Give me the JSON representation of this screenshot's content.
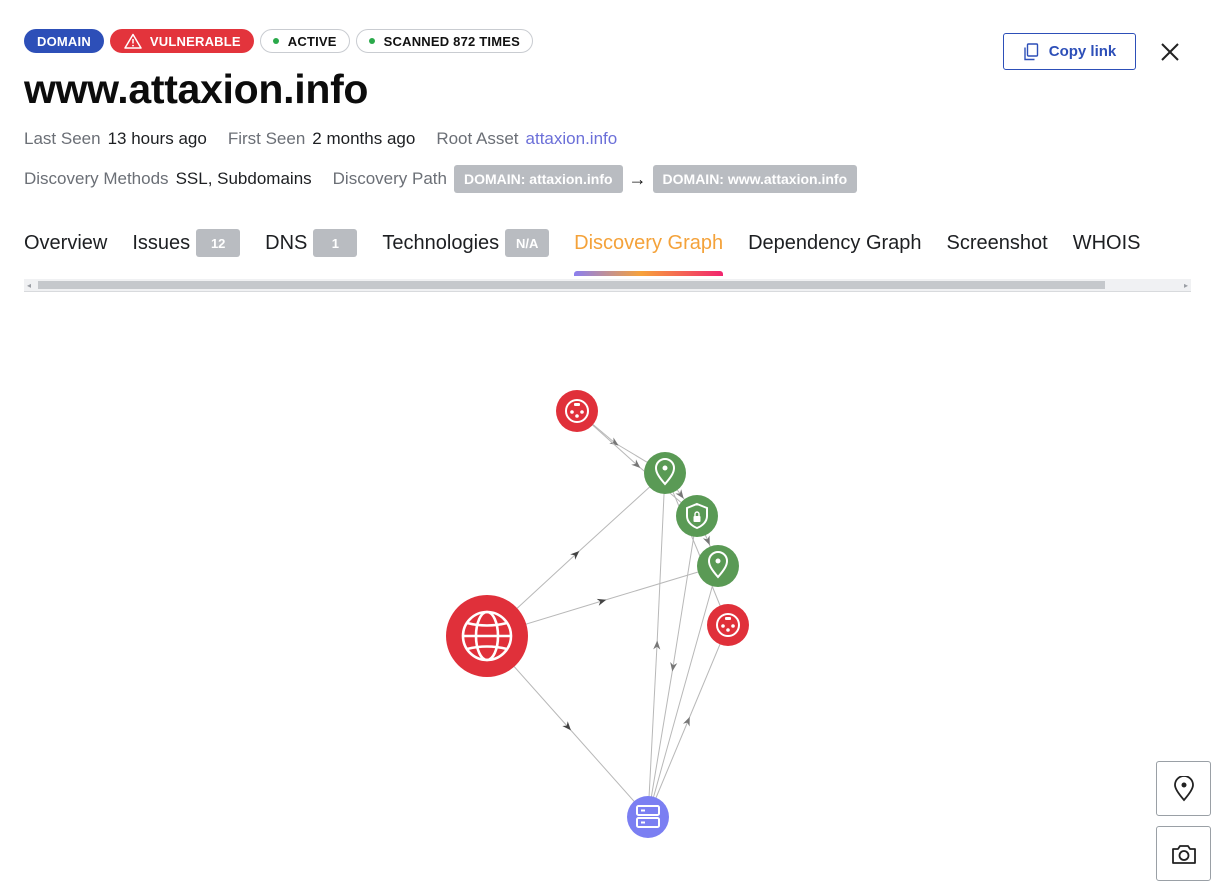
{
  "header": {
    "badges": {
      "type": "DOMAIN",
      "severity": "VULNERABLE",
      "status": "ACTIVE",
      "scans": "SCANNED 872 TIMES"
    },
    "copy_link_label": "Copy link",
    "title": "www.attaxion.info"
  },
  "meta": {
    "last_seen_key": "Last Seen",
    "last_seen_value": "13 hours ago",
    "first_seen_key": "First Seen",
    "first_seen_value": "2 months ago",
    "root_asset_key": "Root Asset",
    "root_asset_value": "attaxion.info",
    "discovery_methods_key": "Discovery Methods",
    "discovery_methods_value": "SSL, Subdomains",
    "discovery_path_key": "Discovery Path",
    "discovery_path_from": "DOMAIN: attaxion.info",
    "discovery_path_arrow": "→",
    "discovery_path_to": "DOMAIN: www.attaxion.info"
  },
  "tabs": [
    {
      "label": "Overview"
    },
    {
      "label": "Issues",
      "count": "12"
    },
    {
      "label": "DNS",
      "count": "1"
    },
    {
      "label": "Technologies",
      "count": "N/A"
    },
    {
      "label": "Discovery Graph",
      "active": true
    },
    {
      "label": "Dependency Graph"
    },
    {
      "label": "Screenshot"
    },
    {
      "label": "WHOIS"
    }
  ],
  "graph": {
    "nodes": [
      {
        "id": "target",
        "kind": "domain",
        "icon": "globe-icon",
        "color": "#e0303a"
      },
      {
        "id": "cert-top",
        "kind": "certificate",
        "icon": "certificate-icon",
        "color": "#e0303a"
      },
      {
        "id": "loc-1",
        "kind": "location",
        "icon": "map-pin-icon",
        "color": "#5a9a55"
      },
      {
        "id": "ssl",
        "kind": "ssl",
        "icon": "shield-lock-icon",
        "color": "#5a9a55"
      },
      {
        "id": "loc-2",
        "kind": "location",
        "icon": "map-pin-icon",
        "color": "#5a9a55"
      },
      {
        "id": "cert-right",
        "kind": "certificate",
        "icon": "certificate-icon",
        "color": "#e0303a"
      },
      {
        "id": "server",
        "kind": "server",
        "icon": "server-icon",
        "color": "#7b7ff2"
      }
    ]
  },
  "side_controls": {
    "locate_icon": "map-pin-icon",
    "screenshot_icon": "camera-icon"
  },
  "colors": {
    "domain_badge": "#2d4fb8",
    "vulnerable_badge": "#e3343c",
    "active_dot": "#2aa94a",
    "active_tab": "#f4a23a",
    "link": "#6b6fd8"
  }
}
